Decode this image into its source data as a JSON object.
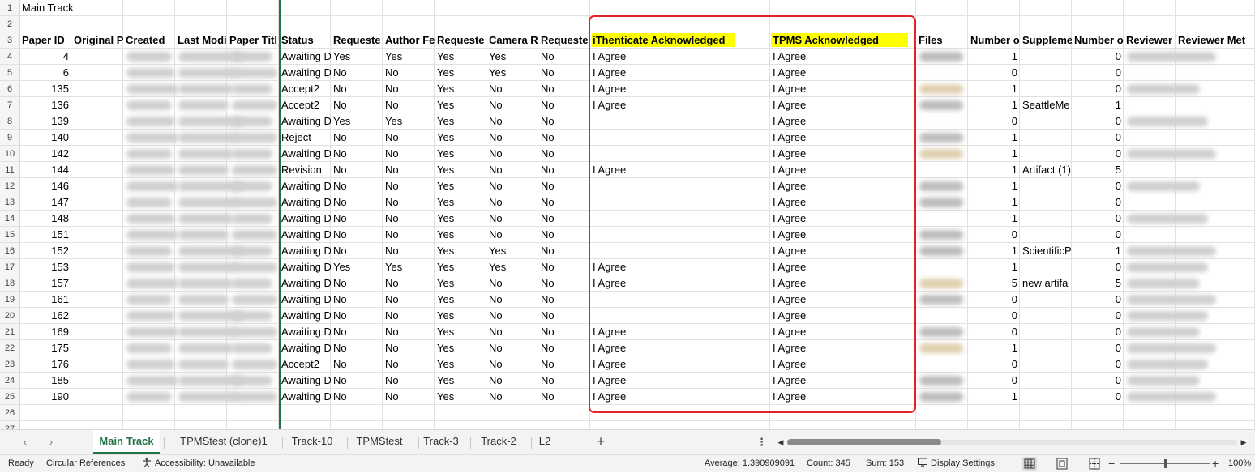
{
  "title_cell": "Main Track",
  "columns": [
    "Paper ID",
    "Original P",
    "Created",
    "Last Modi",
    "Paper Titl",
    "Status",
    "Requeste",
    "Author Fe",
    "Requeste",
    "Camera R",
    "Requeste",
    "iThenticate Acknowledged",
    "TPMS Acknowledged",
    "Files",
    "Number o",
    "Suppleme",
    "Number o",
    "Reviewer",
    "Reviewer Met"
  ],
  "row_numbers": [
    "1",
    "2",
    "3",
    "4",
    "5",
    "6",
    "7",
    "8",
    "9",
    "10",
    "11",
    "12",
    "13",
    "14",
    "15",
    "16",
    "17",
    "18",
    "19",
    "20",
    "21",
    "22",
    "23",
    "24",
    "25",
    "26",
    "27"
  ],
  "rows": [
    {
      "id": "4",
      "status": "Awaiting D",
      "c7": "Yes",
      "c8": "Yes",
      "c9": "Yes",
      "c10": "Yes",
      "c11": "No",
      "ith": "I Agree",
      "tpms": "I Agree",
      "n1": "1",
      "supp": "",
      "n2": "0"
    },
    {
      "id": "6",
      "status": "Awaiting D",
      "c7": "No",
      "c8": "No",
      "c9": "Yes",
      "c10": "Yes",
      "c11": "No",
      "ith": "I Agree",
      "tpms": "I Agree",
      "n1": "0",
      "supp": "",
      "n2": "0"
    },
    {
      "id": "135",
      "status": "Accept2",
      "c7": "No",
      "c8": "No",
      "c9": "Yes",
      "c10": "No",
      "c11": "No",
      "ith": "I Agree",
      "tpms": "I Agree",
      "n1": "1",
      "supp": "",
      "n2": "0"
    },
    {
      "id": "136",
      "status": "Accept2",
      "c7": "No",
      "c8": "No",
      "c9": "Yes",
      "c10": "No",
      "c11": "No",
      "ith": "I Agree",
      "tpms": "I Agree",
      "n1": "1",
      "supp": "SeattleMe",
      "n2": "1"
    },
    {
      "id": "139",
      "status": "Awaiting D",
      "c7": "Yes",
      "c8": "Yes",
      "c9": "Yes",
      "c10": "No",
      "c11": "No",
      "ith": "",
      "tpms": "I Agree",
      "n1": "0",
      "supp": "",
      "n2": "0"
    },
    {
      "id": "140",
      "status": "Reject",
      "c7": "No",
      "c8": "No",
      "c9": "Yes",
      "c10": "No",
      "c11": "No",
      "ith": "",
      "tpms": "I Agree",
      "n1": "1",
      "supp": "",
      "n2": "0"
    },
    {
      "id": "142",
      "status": "Awaiting D",
      "c7": "No",
      "c8": "No",
      "c9": "Yes",
      "c10": "No",
      "c11": "No",
      "ith": "",
      "tpms": "I Agree",
      "n1": "1",
      "supp": "",
      "n2": "0"
    },
    {
      "id": "144",
      "status": "Revision",
      "c7": "No",
      "c8": "No",
      "c9": "Yes",
      "c10": "No",
      "c11": "No",
      "ith": "I Agree",
      "tpms": "I Agree",
      "n1": "1",
      "supp": "Artifact (1)",
      "n2": "5"
    },
    {
      "id": "146",
      "status": "Awaiting D",
      "c7": "No",
      "c8": "No",
      "c9": "Yes",
      "c10": "No",
      "c11": "No",
      "ith": "",
      "tpms": "I Agree",
      "n1": "1",
      "supp": "",
      "n2": "0"
    },
    {
      "id": "147",
      "status": "Awaiting D",
      "c7": "No",
      "c8": "No",
      "c9": "Yes",
      "c10": "No",
      "c11": "No",
      "ith": "",
      "tpms": "I Agree",
      "n1": "1",
      "supp": "",
      "n2": "0"
    },
    {
      "id": "148",
      "status": "Awaiting D",
      "c7": "No",
      "c8": "No",
      "c9": "Yes",
      "c10": "No",
      "c11": "No",
      "ith": "",
      "tpms": "I Agree",
      "n1": "1",
      "supp": "",
      "n2": "0"
    },
    {
      "id": "151",
      "status": "Awaiting D",
      "c7": "No",
      "c8": "No",
      "c9": "Yes",
      "c10": "No",
      "c11": "No",
      "ith": "",
      "tpms": "I Agree",
      "n1": "0",
      "supp": "",
      "n2": "0"
    },
    {
      "id": "152",
      "status": "Awaiting D",
      "c7": "No",
      "c8": "No",
      "c9": "Yes",
      "c10": "Yes",
      "c11": "No",
      "ith": "",
      "tpms": "I Agree",
      "n1": "1",
      "supp": "ScientificP",
      "n2": "1"
    },
    {
      "id": "153",
      "status": "Awaiting D",
      "c7": "Yes",
      "c8": "Yes",
      "c9": "Yes",
      "c10": "Yes",
      "c11": "No",
      "ith": "I Agree",
      "tpms": "I Agree",
      "n1": "1",
      "supp": "",
      "n2": "0"
    },
    {
      "id": "157",
      "status": "Awaiting D",
      "c7": "No",
      "c8": "No",
      "c9": "Yes",
      "c10": "No",
      "c11": "No",
      "ith": "I Agree",
      "tpms": "I Agree",
      "n1": "5",
      "supp": "new artifa",
      "n2": "5"
    },
    {
      "id": "161",
      "status": "Awaiting D",
      "c7": "No",
      "c8": "No",
      "c9": "Yes",
      "c10": "No",
      "c11": "No",
      "ith": "",
      "tpms": "I Agree",
      "n1": "0",
      "supp": "",
      "n2": "0"
    },
    {
      "id": "162",
      "status": "Awaiting D",
      "c7": "No",
      "c8": "No",
      "c9": "Yes",
      "c10": "No",
      "c11": "No",
      "ith": "",
      "tpms": "I Agree",
      "n1": "0",
      "supp": "",
      "n2": "0"
    },
    {
      "id": "169",
      "status": "Awaiting D",
      "c7": "No",
      "c8": "No",
      "c9": "Yes",
      "c10": "No",
      "c11": "No",
      "ith": "I Agree",
      "tpms": "I Agree",
      "n1": "0",
      "supp": "",
      "n2": "0"
    },
    {
      "id": "175",
      "status": "Awaiting D",
      "c7": "No",
      "c8": "No",
      "c9": "Yes",
      "c10": "No",
      "c11": "No",
      "ith": "I Agree",
      "tpms": "I Agree",
      "n1": "1",
      "supp": "",
      "n2": "0"
    },
    {
      "id": "176",
      "status": "Accept2",
      "c7": "No",
      "c8": "No",
      "c9": "Yes",
      "c10": "No",
      "c11": "No",
      "ith": "I Agree",
      "tpms": "I Agree",
      "n1": "0",
      "supp": "",
      "n2": "0"
    },
    {
      "id": "185",
      "status": "Awaiting D",
      "c7": "No",
      "c8": "No",
      "c9": "Yes",
      "c10": "No",
      "c11": "No",
      "ith": "I Agree",
      "tpms": "I Agree",
      "n1": "0",
      "supp": "",
      "n2": "0"
    },
    {
      "id": "190",
      "status": "Awaiting D",
      "c7": "No",
      "c8": "No",
      "c9": "Yes",
      "c10": "No",
      "c11": "No",
      "ith": "I Agree",
      "tpms": "I Agree",
      "n1": "1",
      "supp": "",
      "n2": "0"
    }
  ],
  "highlight_color": "#ffff00",
  "annotation_color": "#e0242a",
  "accent_color": "#217346",
  "sheet_tabs": [
    "Main Track",
    "TPMStest (clone)1",
    "Track-10",
    "TPMStest",
    "Track-3",
    "Track-2",
    "L2"
  ],
  "active_sheet": "Main Track",
  "add_sheet_label": "+",
  "more_label": "⋮",
  "status_bar": {
    "ready": "Ready",
    "circular": "Circular References",
    "accessibility": "Accessibility: Unavailable",
    "average": "Average: 1.390909091",
    "count": "Count: 345",
    "sum": "Sum: 153",
    "display_settings": "Display Settings",
    "zoom_minus": "−",
    "zoom_plus": "+",
    "zoom": "100%"
  },
  "icons": {
    "scroll_left": "‹",
    "scroll_right": "›",
    "hscroll_left": "◀",
    "hscroll_right": "▶"
  }
}
